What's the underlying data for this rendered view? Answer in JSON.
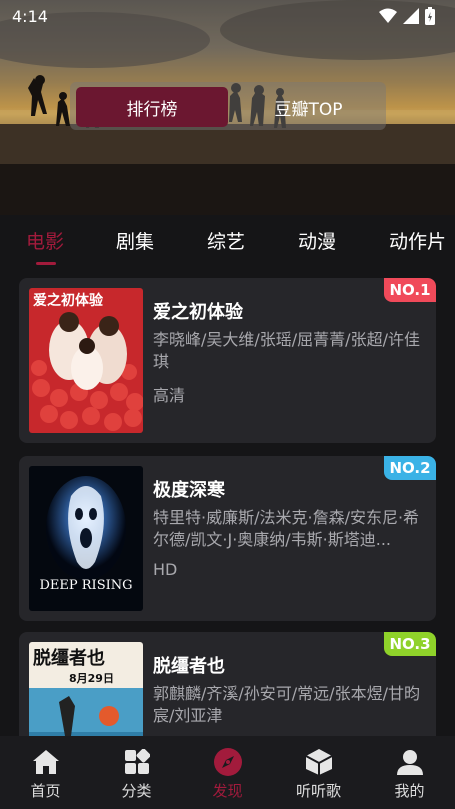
{
  "status_bar": {
    "time": "4:14"
  },
  "hero": {
    "switch_options": [
      "排行榜",
      "豆瓣TOP"
    ],
    "selected_option": "排行榜"
  },
  "tabs": [
    "电影",
    "剧集",
    "综艺",
    "动漫",
    "动作片"
  ],
  "active_tab": "电影",
  "movies": [
    {
      "rank": "NO.1",
      "rank_color": "#f04a5a",
      "title": "爱之初体验",
      "cast": "李晓峰/吴大维/张瑶/屈菁菁/张超/许佳琪",
      "quality": "高清",
      "poster_text": "爱之初体验"
    },
    {
      "rank": "NO.2",
      "rank_color": "#3ab2e6",
      "title": "极度深寒",
      "cast": "特里特·威廉斯/法米克·詹森/安东尼·希尔德/凯文·J·奥康纳/韦斯·斯塔迪...",
      "quality": "HD",
      "poster_text": "DEEP RISING"
    },
    {
      "rank": "NO.3",
      "rank_color": "#8fd22a",
      "title": "脱缰者也",
      "cast": "郭麒麟/齐溪/孙安可/常远/张本煜/甘昀宸/刘亚津",
      "quality": "",
      "poster_text": "脱缰者也",
      "poster_date": "8月29日"
    }
  ],
  "bottom_nav": {
    "items": [
      {
        "label": "首页",
        "icon": "home-icon"
      },
      {
        "label": "分类",
        "icon": "grid-icon"
      },
      {
        "label": "发现",
        "icon": "compass-icon"
      },
      {
        "label": "听听歌",
        "icon": "cube-icon"
      },
      {
        "label": "我的",
        "icon": "user-icon"
      }
    ],
    "active": "发现",
    "active_color": "#a21b3c"
  }
}
